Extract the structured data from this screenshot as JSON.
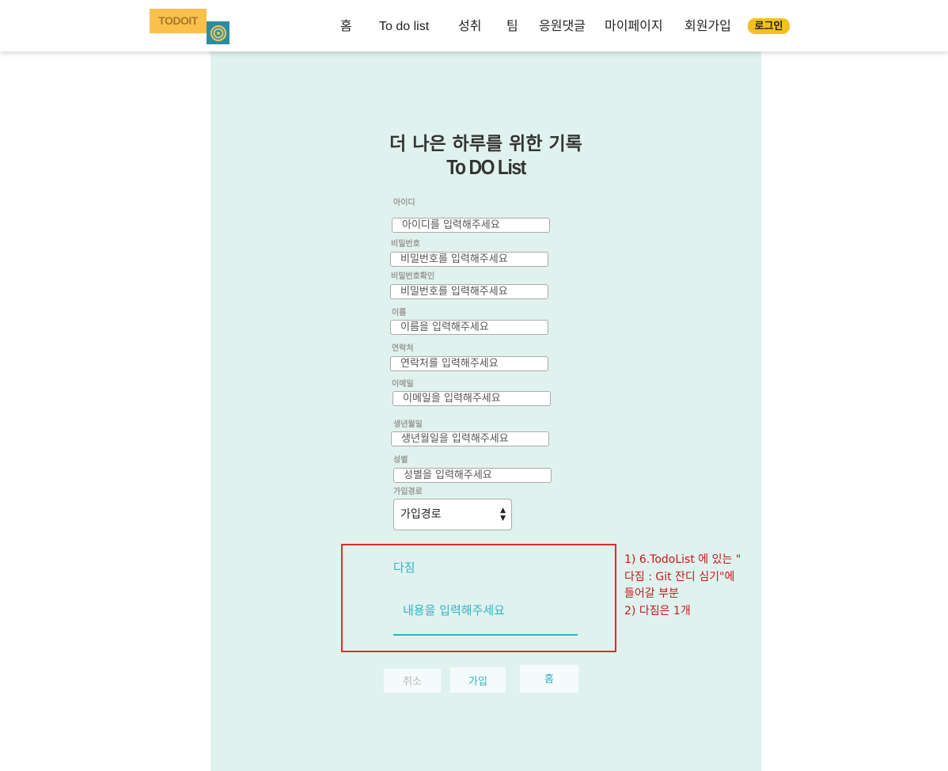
{
  "header": {
    "logo_text": "TODOIT",
    "nav": [
      "홈",
      "To do list",
      "성취",
      "팀",
      "응원댓글",
      "마이페이지",
      "회원가입"
    ],
    "login_label": "로그인"
  },
  "page": {
    "title_line1": "더 나은 하루를 위한 기록",
    "title_line2": "To DO List"
  },
  "form": {
    "fields": [
      {
        "label": "아이디",
        "placeholder": "아이디를 입력해주세요"
      },
      {
        "label": "비밀번호",
        "placeholder": "비밀번호를 입력해주세요"
      },
      {
        "label": "비밀번호확인",
        "placeholder": "비밀번호를 입력해주세요"
      },
      {
        "label": "이름",
        "placeholder": "이름을 입력해주세요"
      },
      {
        "label": "연락처",
        "placeholder": "연락처를 입력해주세요"
      },
      {
        "label": "이메일",
        "placeholder": "이메일을 입력해주세요"
      },
      {
        "label": "생년월일",
        "placeholder": "생년월일을 입력해주세요"
      },
      {
        "label": "성별",
        "placeholder": "성별을 입력해주세요"
      }
    ],
    "signup_path": {
      "label": "가입경로",
      "selected": "가입경로"
    },
    "resolution": {
      "label": "다짐",
      "placeholder": "내용을 입력해주세요"
    }
  },
  "annotation": {
    "lines": [
      "1) 6.TodoList 에 있는 \"",
      "다짐 : Git 잔디 심기\"에",
      "들어갈 부분",
      "2) 다짐은 1개"
    ]
  },
  "buttons": {
    "cancel": "취소",
    "join": "가입",
    "home": "홈"
  },
  "colors": {
    "background": "#e0f2ee",
    "accent": "#2fb3c4",
    "login": "#f3c11d",
    "annotation": "#c41818"
  }
}
